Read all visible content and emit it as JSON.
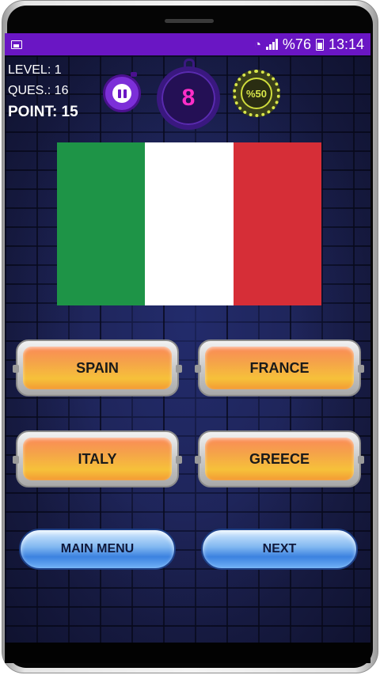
{
  "status_bar": {
    "percent_sign_battery": "%76",
    "time": "13:14"
  },
  "hud": {
    "level": "LEVEL: 1",
    "question": "QUES.: 16",
    "point": "POINT: 15",
    "timer_value": "8",
    "joker_label": "%50"
  },
  "flag": {
    "colors": [
      "#1e9447",
      "#ffffff",
      "#d62e37"
    ]
  },
  "answers": [
    "SPAIN",
    "FRANCE",
    "ITALY",
    "GREECE"
  ],
  "buttons": {
    "main_menu": "MAIN MENU",
    "next": "NEXT"
  },
  "theme": {
    "accent": "#6a16c4",
    "timer_digit": "#ff2ec8",
    "answer_orange": "#f6c13a",
    "pill_blue": "#3c82e0"
  }
}
